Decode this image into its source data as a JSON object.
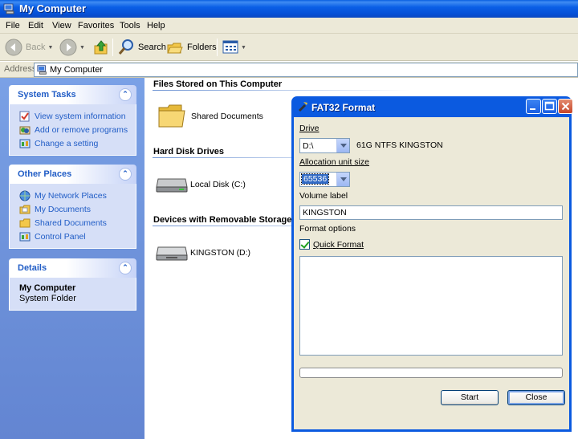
{
  "window": {
    "title": "My Computer"
  },
  "menu": [
    "File",
    "Edit",
    "View",
    "Favorites",
    "Tools",
    "Help"
  ],
  "toolbar": {
    "back": "Back",
    "search": "Search",
    "folders": "Folders"
  },
  "address": {
    "label": "Address",
    "value": "My Computer"
  },
  "left_pane": {
    "system_tasks": {
      "title": "System Tasks",
      "items": [
        "View system information",
        "Add or remove programs",
        "Change a setting"
      ]
    },
    "other_places": {
      "title": "Other Places",
      "items": [
        "My Network Places",
        "My Documents",
        "Shared Documents",
        "Control Panel"
      ]
    },
    "details": {
      "title": "Details",
      "name": "My Computer",
      "type": "System Folder"
    }
  },
  "content": {
    "groups": [
      {
        "title": "Files Stored on This Computer",
        "items": [
          "Shared Documents"
        ]
      },
      {
        "title": "Hard Disk Drives",
        "items": [
          "Local Disk (C:)"
        ]
      },
      {
        "title": "Devices with Removable Storage",
        "items": [
          "KINGSTON (D:)"
        ]
      }
    ]
  },
  "dialog": {
    "title": "FAT32 Format",
    "drive_label": "Drive",
    "drive_value": "D:\\",
    "drive_info": "61G NTFS KINGSTON",
    "alloc_label": "Allocation unit size",
    "alloc_value": "65536",
    "volume_label": "Volume label",
    "volume_value": "KINGSTON",
    "format_options_label": "Format options",
    "quick_format_label": "Quick Format",
    "quick_format_checked": true,
    "start_button": "Start",
    "close_button": "Close"
  }
}
